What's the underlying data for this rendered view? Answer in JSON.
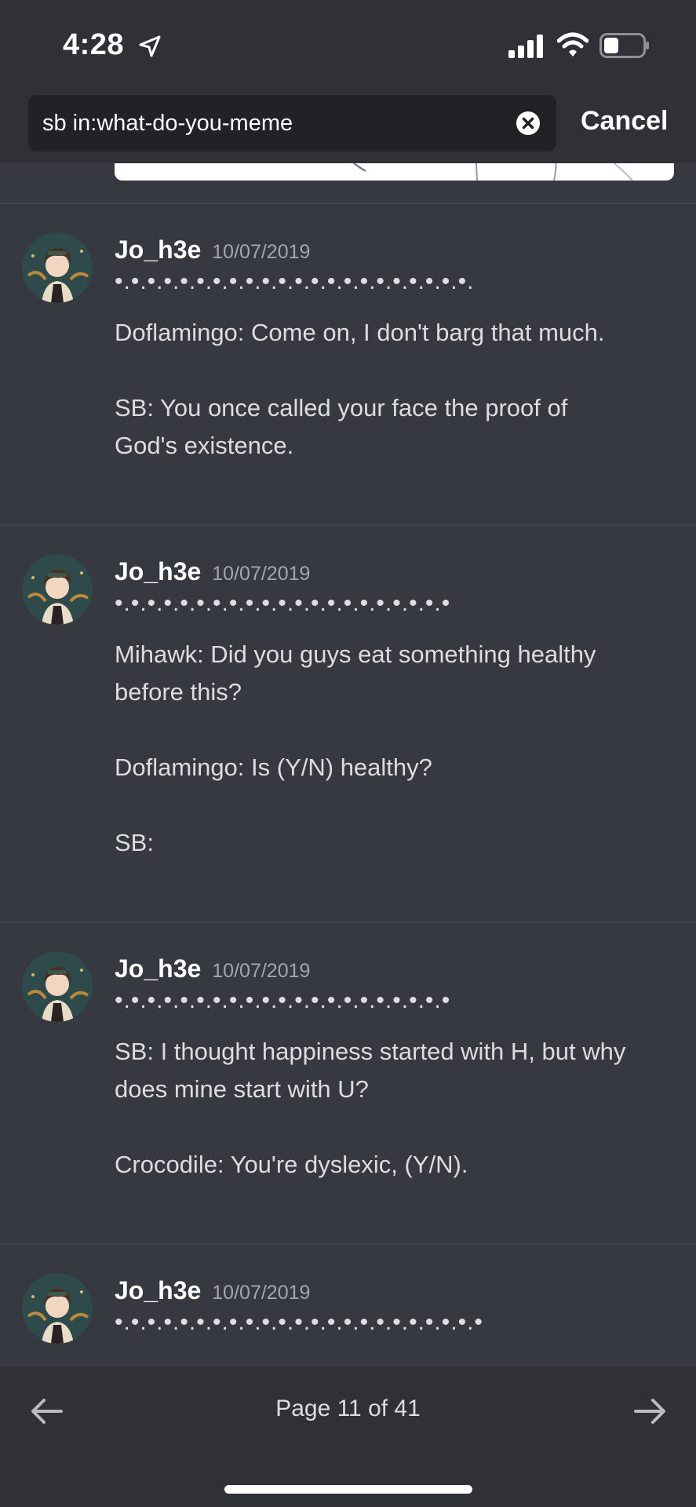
{
  "status_bar": {
    "time": "4:28",
    "icons": [
      "location-arrow-icon",
      "cellular-signal-icon",
      "wifi-icon",
      "battery-icon"
    ]
  },
  "search": {
    "query": "sb in:what-do-you-meme",
    "cancel_label": "Cancel"
  },
  "results": [
    {
      "username": "Jo_h3e",
      "date": "10/07/2019",
      "dots": "•.•.•.•.•.•.•.•.•.•.•.•.•.•.•.•.•.•.•.•.•.•.",
      "lines": [
        "Doflamingo: Come on, I don't barg that much.",
        "",
        "SB: You once called your face the proof of",
        "God's existence."
      ]
    },
    {
      "username": "Jo_h3e",
      "date": "10/07/2019",
      "dots": "•.•.•.•.•.•.•.•.•.•.•.•.•.•.•.•.•.•.•.•.•",
      "lines": [
        "Mihawk: Did you guys eat something healthy",
        "before this?",
        "",
        "Doflamingo: Is (Y/N) healthy?",
        "",
        "SB:"
      ]
    },
    {
      "username": "Jo_h3e",
      "date": "10/07/2019",
      "dots": "•.•.•.•.•.•.•.•.•.•.•.•.•.•.•.•.•.•.•.•.•",
      "lines": [
        "SB: I thought happiness started with H, but why",
        "does mine start with U?",
        "",
        "Crocodile: You're dyslexic, (Y/N)."
      ]
    },
    {
      "username": "Jo_h3e",
      "date": "10/07/2019",
      "dots": "•.•.•.•.•.•.•.•.•.•.•.•.•.•.•.•.•.•.•.•.•.•.•",
      "lines": []
    }
  ],
  "pagination": {
    "label": "Page 11 of 41"
  },
  "colors": {
    "background": "#36393f",
    "bars": "#2f3136",
    "search_field": "#202225",
    "separator": "#40444b",
    "text": "#dcddde",
    "timestamp": "#a3a6aa"
  }
}
